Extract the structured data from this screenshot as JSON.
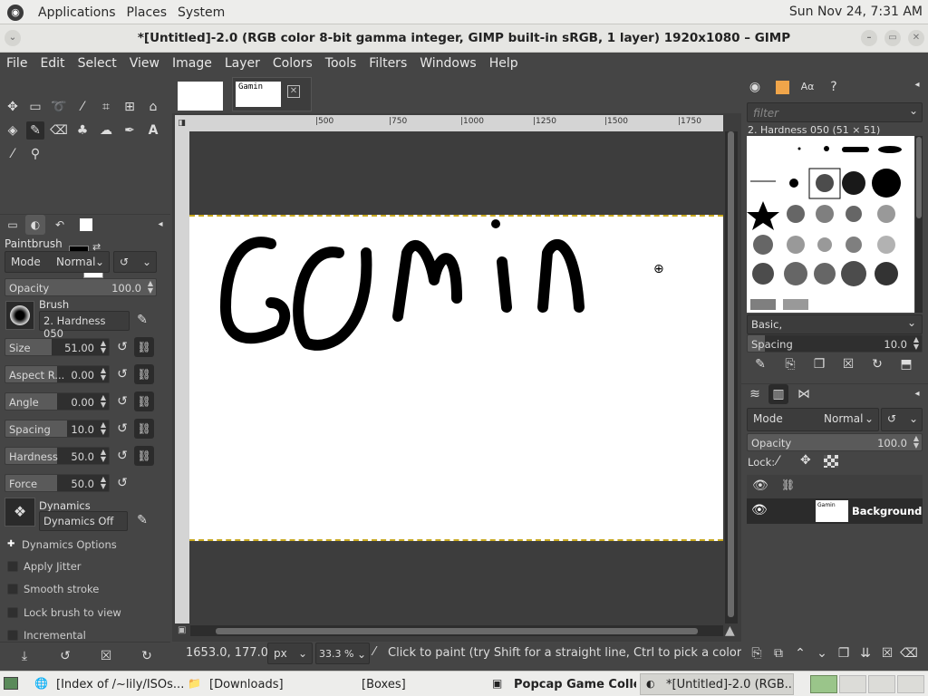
{
  "top_panel": {
    "menu": [
      "Applications",
      "Places",
      "System"
    ],
    "clock": "Sun Nov 24,  7:31 AM"
  },
  "window": {
    "title": "*[Untitled]-2.0 (RGB color 8-bit gamma integer, GIMP built-in sRGB, 1 layer) 1920x1080 – GIMP"
  },
  "menubar": [
    "File",
    "Edit",
    "Select",
    "View",
    "Image",
    "Layer",
    "Colors",
    "Tools",
    "Filters",
    "Windows",
    "Help"
  ],
  "tool_options": {
    "title": "Paintbrush",
    "mode_label": "Mode",
    "mode_value": "Normal",
    "opacity": {
      "label": "Opacity",
      "value": "100.0"
    },
    "brush_label": "Brush",
    "brush_value": "2. Hardness 050",
    "sliders": [
      {
        "label": "Size",
        "value": "51.00",
        "fill": 0.45
      },
      {
        "label": "Aspect R...",
        "value": "0.00",
        "fill": 0.5
      },
      {
        "label": "Angle",
        "value": "0.00",
        "fill": 0.5
      },
      {
        "label": "Spacing",
        "value": "10.0",
        "fill": 0.6
      },
      {
        "label": "Hardness",
        "value": "50.0",
        "fill": 0.5
      },
      {
        "label": "Force",
        "value": "50.0",
        "fill": 0.5
      }
    ],
    "dynamics_label": "Dynamics",
    "dynamics_value": "Dynamics Off",
    "dynamics_options": "Dynamics Options",
    "checks": [
      "Apply Jitter",
      "Smooth stroke",
      "Lock brush to view",
      "Incremental"
    ]
  },
  "canvas": {
    "ruler_marks": [
      "|500",
      "|750",
      "|1000",
      "|1250",
      "|1500",
      "|1750"
    ],
    "drawing_text": "Gamin",
    "thumb_text": "Gamin"
  },
  "statusbar": {
    "coords": "1653.0, 177.0",
    "unit": "px",
    "zoom": "33.3 %",
    "message": "Click to paint (try Shift for a straight line, Ctrl to pick a color)"
  },
  "right_dock": {
    "filter_placeholder": "filter",
    "brush_name": "2. Hardness 050 (51 × 51)",
    "brush_set": "Basic,",
    "spacing": {
      "label": "Spacing",
      "value": "10.0"
    },
    "layers": {
      "mode_label": "Mode",
      "mode_value": "Normal",
      "opacity": {
        "label": "Opacity",
        "value": "100.0"
      },
      "lock_label": "Lock:",
      "layer_name": "Background",
      "thumb_text": "Gamin"
    }
  },
  "taskbar": [
    "[Index of /~lily/ISOs...",
    "[Downloads]",
    "[Boxes]",
    "Popcap Game Colle...",
    "*[Untitled]-2.0 (RGB..."
  ]
}
